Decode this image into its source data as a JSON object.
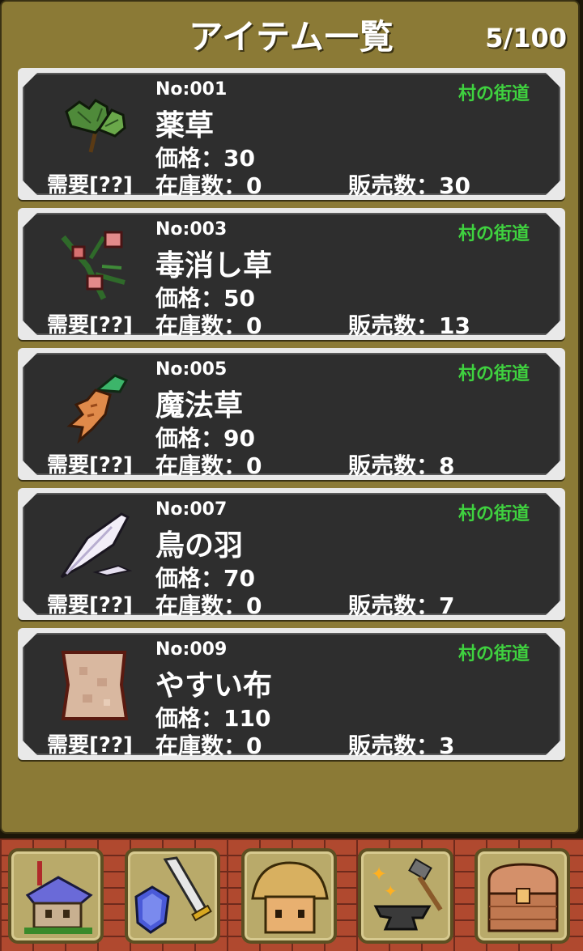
{
  "header": {
    "title": "アイテム一覧",
    "count": "5/100"
  },
  "items": [
    {
      "no": "No:001",
      "name": "薬草",
      "price": "価格：30",
      "demand": "需要[??]",
      "stock": "在庫数：0",
      "sold": "販売数：30",
      "area": "村の街道",
      "icon": "herb-icon"
    },
    {
      "no": "No:003",
      "name": "毒消し草",
      "price": "価格：50",
      "demand": "需要[??]",
      "stock": "在庫数：0",
      "sold": "販売数：13",
      "area": "村の街道",
      "icon": "antidote-herb-icon"
    },
    {
      "no": "No:005",
      "name": "魔法草",
      "price": "価格：90",
      "demand": "需要[??]",
      "stock": "在庫数：0",
      "sold": "販売数：8",
      "area": "村の街道",
      "icon": "magic-root-icon"
    },
    {
      "no": "No:007",
      "name": "鳥の羽",
      "price": "価格：70",
      "demand": "需要[??]",
      "stock": "在庫数：0",
      "sold": "販売数：7",
      "area": "村の街道",
      "icon": "feather-icon"
    },
    {
      "no": "No:009",
      "name": "やすい布",
      "price": "価格：110",
      "demand": "需要[??]",
      "stock": "在庫数：0",
      "sold": "販売数：3",
      "area": "村の街道",
      "icon": "cloth-icon"
    }
  ],
  "nav": [
    {
      "icon": "house-icon"
    },
    {
      "icon": "sword-shield-icon"
    },
    {
      "icon": "shopkeeper-icon"
    },
    {
      "icon": "anvil-hammer-icon"
    },
    {
      "icon": "treasure-chest-icon"
    }
  ],
  "colors": {
    "area_text": "#3fd13f",
    "panel": "#8b7a36",
    "card": "#2e2e2e",
    "brick": "#b0492f"
  }
}
